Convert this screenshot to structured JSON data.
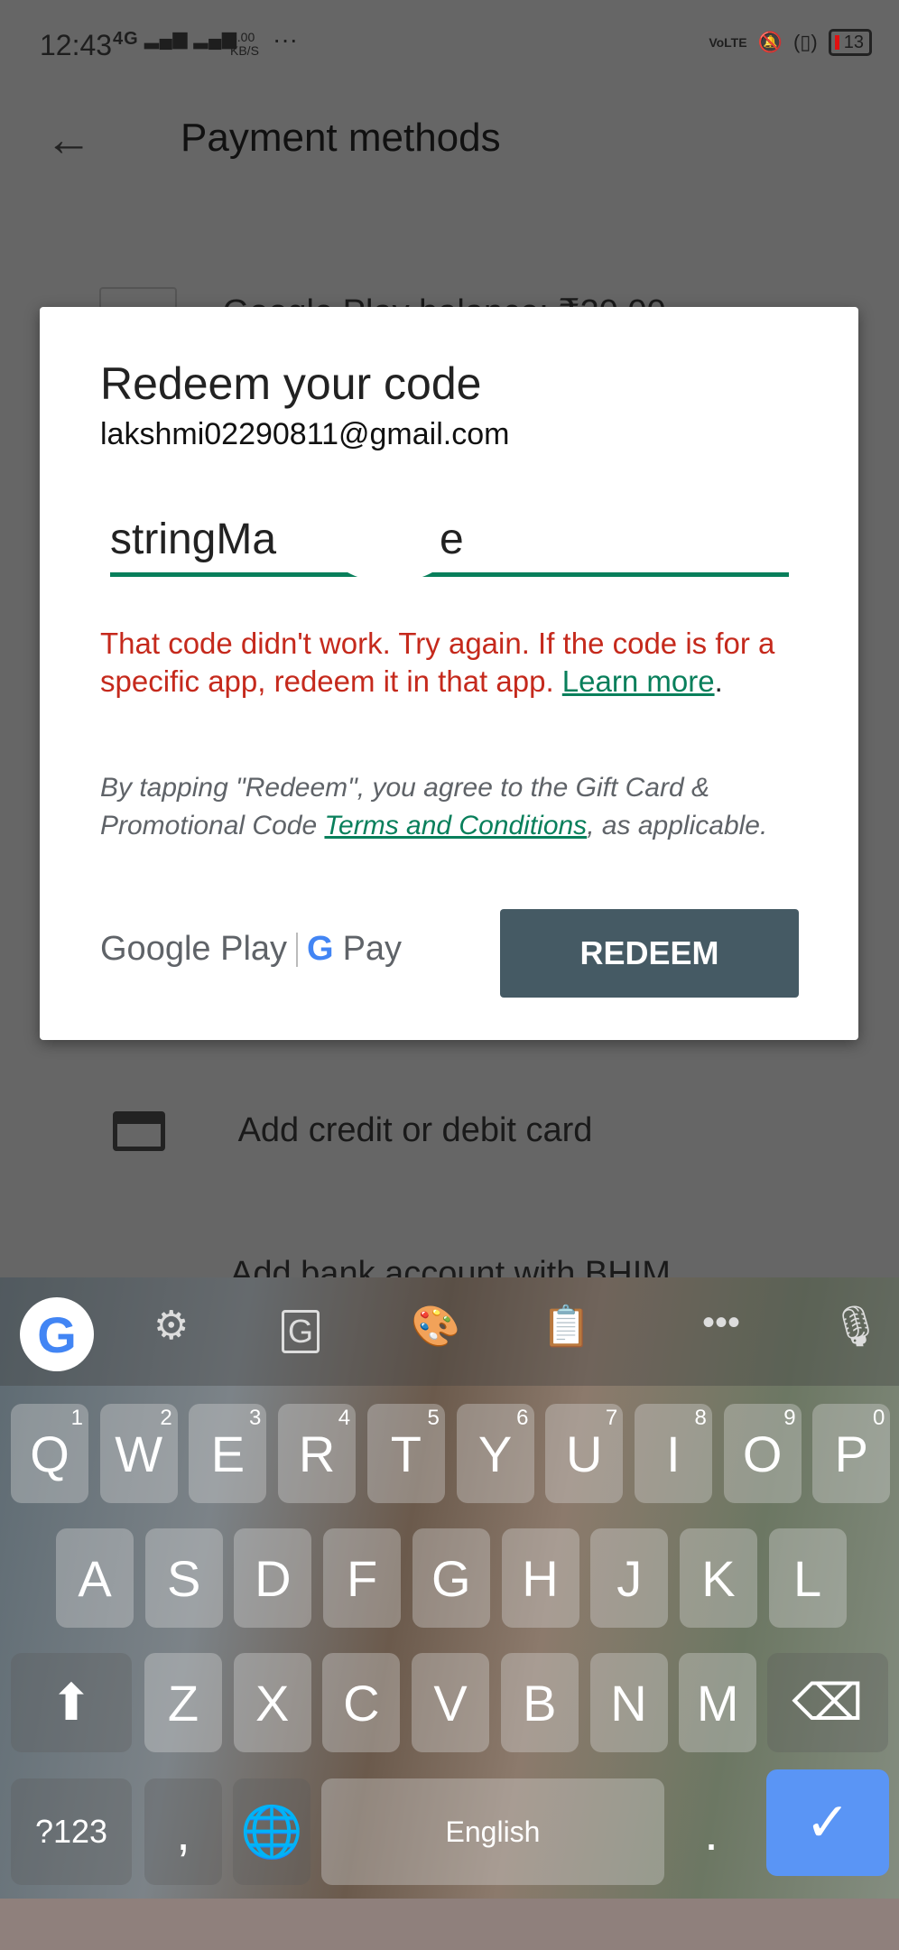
{
  "status": {
    "time": "12:43",
    "network": "4G",
    "speed_value": "3.00",
    "speed_unit": "KB/S",
    "more": "···",
    "volte": "VoLTE",
    "battery": "13"
  },
  "appbar": {
    "title": "Payment methods"
  },
  "background_items": [
    "Google Play balance: ₹20.00",
    "Add credit or debit card",
    "Add bank account with BHIM"
  ],
  "dialog": {
    "title": "Redeem your code",
    "email": "lakshmi02290811@gmail.com",
    "code_value_start": "stringMa",
    "code_value_end": "e",
    "error_text": "That code didn't work. Try again. If the code is for a specific app, redeem it in that app. ",
    "error_link": "Learn more",
    "terms_prefix": "By tapping \"Redeem\", you agree to the Gift Card & Promotional Code ",
    "terms_link": "Terms and Conditions",
    "terms_suffix": ", as applicable.",
    "logo_play": "Google Play",
    "logo_pay": "Pay",
    "redeem_label": "REDEEM",
    "accent": "#087f5b",
    "error_color": "#c5291c",
    "button_color": "#455a64"
  },
  "keyboard": {
    "row1": [
      [
        "Q",
        "1"
      ],
      [
        "W",
        "2"
      ],
      [
        "E",
        "3"
      ],
      [
        "R",
        "4"
      ],
      [
        "T",
        "5"
      ],
      [
        "Y",
        "6"
      ],
      [
        "U",
        "7"
      ],
      [
        "I",
        "8"
      ],
      [
        "O",
        "9"
      ],
      [
        "P",
        "0"
      ]
    ],
    "row2": [
      "A",
      "S",
      "D",
      "F",
      "G",
      "H",
      "J",
      "K",
      "L"
    ],
    "row3": [
      "Z",
      "X",
      "C",
      "V",
      "B",
      "N",
      "M"
    ],
    "symbols": "?123",
    "comma": ",",
    "space": "English",
    "period": ".",
    "enter_color": "#5a95f5"
  }
}
